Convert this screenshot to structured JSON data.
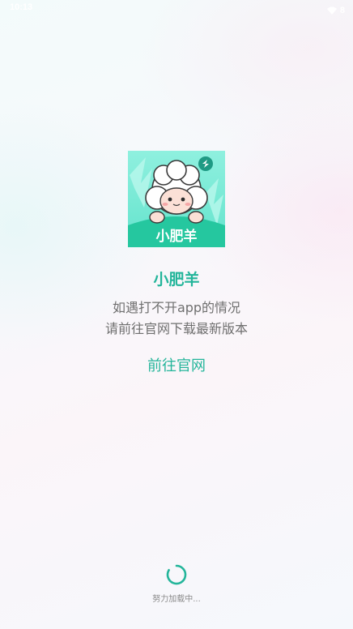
{
  "status_bar": {
    "time": "10:13",
    "battery": "8"
  },
  "app": {
    "logo_text": "小肥羊",
    "name": "小肥羊"
  },
  "message": {
    "line1": "如遇打不开app的情况",
    "line2": "请前往官网下载最新版本"
  },
  "actions": {
    "website_label": "前往官网"
  },
  "loading": {
    "text": "努力加载中..."
  },
  "colors": {
    "accent": "#23b59a",
    "text_secondary": "#6f6f6f"
  }
}
